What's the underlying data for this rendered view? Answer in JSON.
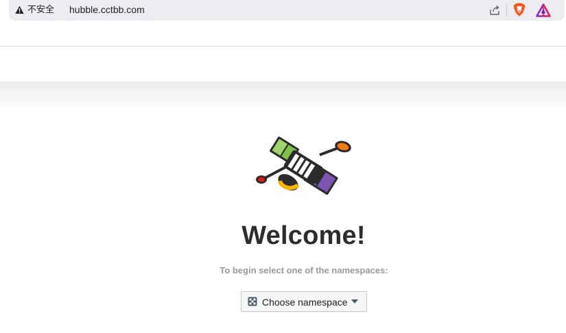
{
  "browser": {
    "security_label": "不安全",
    "url": "hubble.cctbb.com",
    "icons": [
      "warning-icon",
      "share-icon",
      "brave-shields-icon",
      "brave-rewards-icon"
    ]
  },
  "main": {
    "logo": "hubble-satellite-logo",
    "title": "Welcome!",
    "subtitle": "To begin select one of the namespaces:",
    "namespace_button": {
      "label": "Choose namespace",
      "icon": "namespace-icon"
    }
  },
  "colors": {
    "title": "#2d2d2d",
    "subtitle": "#9a9a9a",
    "button_bg": "#f5f6f7",
    "address_bar_bg": "#edecf1"
  }
}
